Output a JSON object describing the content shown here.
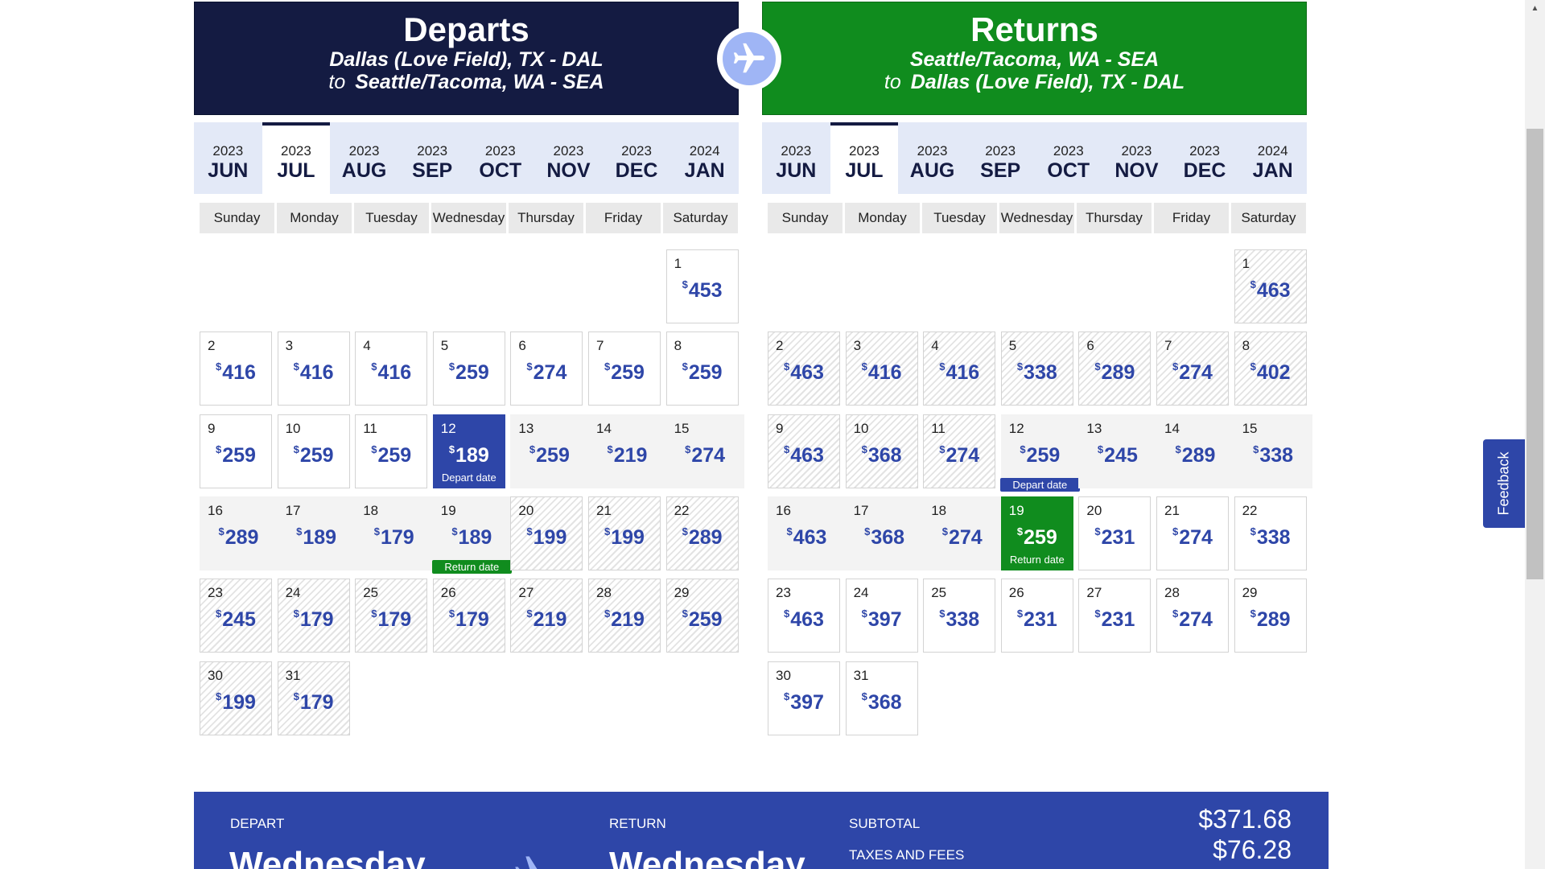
{
  "depart": {
    "title": "Departs",
    "route_line1": "Dallas (Love Field), TX - DAL",
    "route_to": "to",
    "route_line2": "Seattle/Tacoma, WA - SEA",
    "months": [
      {
        "year": "2023",
        "name": "JUN"
      },
      {
        "year": "2023",
        "name": "JUL",
        "active": true
      },
      {
        "year": "2023",
        "name": "AUG"
      },
      {
        "year": "2023",
        "name": "SEP"
      },
      {
        "year": "2023",
        "name": "OCT"
      },
      {
        "year": "2023",
        "name": "NOV"
      },
      {
        "year": "2023",
        "name": "DEC"
      },
      {
        "year": "2024",
        "name": "JAN"
      }
    ],
    "days": [
      {
        "d": 1,
        "p": "453",
        "s": "normal"
      },
      {
        "d": 2,
        "p": "416",
        "s": "normal"
      },
      {
        "d": 3,
        "p": "416",
        "s": "normal"
      },
      {
        "d": 4,
        "p": "416",
        "s": "normal"
      },
      {
        "d": 5,
        "p": "259",
        "s": "normal"
      },
      {
        "d": 6,
        "p": "274",
        "s": "normal"
      },
      {
        "d": 7,
        "p": "259",
        "s": "normal"
      },
      {
        "d": 8,
        "p": "259",
        "s": "normal"
      },
      {
        "d": 9,
        "p": "259",
        "s": "normal"
      },
      {
        "d": 10,
        "p": "259",
        "s": "normal"
      },
      {
        "d": 11,
        "p": "259",
        "s": "normal"
      },
      {
        "d": 12,
        "p": "189",
        "s": "sel-dep",
        "tag": "Depart date"
      },
      {
        "d": 13,
        "p": "259",
        "s": "range"
      },
      {
        "d": 14,
        "p": "219",
        "s": "range"
      },
      {
        "d": 15,
        "p": "274",
        "s": "range"
      },
      {
        "d": 16,
        "p": "289",
        "s": "range"
      },
      {
        "d": 17,
        "p": "189",
        "s": "range"
      },
      {
        "d": 18,
        "p": "179",
        "s": "range"
      },
      {
        "d": 19,
        "p": "189",
        "s": "range",
        "tag": "Return date",
        "tagc": "ret"
      },
      {
        "d": 20,
        "p": "199",
        "s": "hatch"
      },
      {
        "d": 21,
        "p": "199",
        "s": "hatch"
      },
      {
        "d": 22,
        "p": "289",
        "s": "hatch"
      },
      {
        "d": 23,
        "p": "245",
        "s": "hatch"
      },
      {
        "d": 24,
        "p": "179",
        "s": "hatch"
      },
      {
        "d": 25,
        "p": "179",
        "s": "hatch"
      },
      {
        "d": 26,
        "p": "179",
        "s": "hatch"
      },
      {
        "d": 27,
        "p": "219",
        "s": "hatch"
      },
      {
        "d": 28,
        "p": "219",
        "s": "hatch"
      },
      {
        "d": 29,
        "p": "259",
        "s": "hatch"
      },
      {
        "d": 30,
        "p": "199",
        "s": "hatch"
      },
      {
        "d": 31,
        "p": "179",
        "s": "hatch"
      }
    ]
  },
  "return": {
    "title": "Returns",
    "route_line1": "Seattle/Tacoma, WA - SEA",
    "route_to": "to",
    "route_line2": "Dallas (Love Field), TX - DAL",
    "months": [
      {
        "year": "2023",
        "name": "JUN"
      },
      {
        "year": "2023",
        "name": "JUL",
        "active": true
      },
      {
        "year": "2023",
        "name": "AUG"
      },
      {
        "year": "2023",
        "name": "SEP"
      },
      {
        "year": "2023",
        "name": "OCT"
      },
      {
        "year": "2023",
        "name": "NOV"
      },
      {
        "year": "2023",
        "name": "DEC"
      },
      {
        "year": "2024",
        "name": "JAN"
      }
    ],
    "days": [
      {
        "d": 1,
        "p": "463",
        "s": "hatch"
      },
      {
        "d": 2,
        "p": "463",
        "s": "hatch"
      },
      {
        "d": 3,
        "p": "416",
        "s": "hatch"
      },
      {
        "d": 4,
        "p": "416",
        "s": "hatch"
      },
      {
        "d": 5,
        "p": "338",
        "s": "hatch"
      },
      {
        "d": 6,
        "p": "289",
        "s": "hatch"
      },
      {
        "d": 7,
        "p": "274",
        "s": "hatch"
      },
      {
        "d": 8,
        "p": "402",
        "s": "hatch"
      },
      {
        "d": 9,
        "p": "463",
        "s": "hatch"
      },
      {
        "d": 10,
        "p": "368",
        "s": "hatch"
      },
      {
        "d": 11,
        "p": "274",
        "s": "hatch"
      },
      {
        "d": 12,
        "p": "259",
        "s": "range",
        "tag": "Depart date",
        "tagc": "dep"
      },
      {
        "d": 13,
        "p": "245",
        "s": "range"
      },
      {
        "d": 14,
        "p": "289",
        "s": "range"
      },
      {
        "d": 15,
        "p": "338",
        "s": "range"
      },
      {
        "d": 16,
        "p": "463",
        "s": "range"
      },
      {
        "d": 17,
        "p": "368",
        "s": "range"
      },
      {
        "d": 18,
        "p": "274",
        "s": "range"
      },
      {
        "d": 19,
        "p": "259",
        "s": "sel-ret",
        "tag": "Return date"
      },
      {
        "d": 20,
        "p": "231",
        "s": "normal"
      },
      {
        "d": 21,
        "p": "274",
        "s": "normal"
      },
      {
        "d": 22,
        "p": "338",
        "s": "normal"
      },
      {
        "d": 23,
        "p": "463",
        "s": "normal"
      },
      {
        "d": 24,
        "p": "397",
        "s": "normal"
      },
      {
        "d": 25,
        "p": "338",
        "s": "normal"
      },
      {
        "d": 26,
        "p": "231",
        "s": "normal"
      },
      {
        "d": 27,
        "p": "231",
        "s": "normal"
      },
      {
        "d": 28,
        "p": "274",
        "s": "normal"
      },
      {
        "d": 29,
        "p": "289",
        "s": "normal"
      },
      {
        "d": 30,
        "p": "397",
        "s": "normal"
      },
      {
        "d": 31,
        "p": "368",
        "s": "normal"
      }
    ]
  },
  "calendar": {
    "weekdays": [
      "Sunday",
      "Monday",
      "Tuesday",
      "Wednesday",
      "Thursday",
      "Friday",
      "Saturday"
    ],
    "first_weekday_index": 6,
    "currency_symbol": "$"
  },
  "summary": {
    "depart_label": "DEPART",
    "depart_day": "Wednesday",
    "return_label": "RETURN",
    "return_day": "Wednesday",
    "subtotal_label": "SUBTOTAL",
    "subtotal_value": "$371.68",
    "taxes_label": "TAXES AND FEES",
    "taxes_value": "$76.28"
  },
  "feedback_label": "Feedback",
  "icons": {
    "swap": "airplane-icon",
    "summary": "airplane-icon",
    "scroll_up": "scroll-up-arrow-icon"
  },
  "colors": {
    "navy": "#141b42",
    "green": "#108c1e",
    "blue": "#2e46a8",
    "month_bg": "#e3e9f7"
  }
}
